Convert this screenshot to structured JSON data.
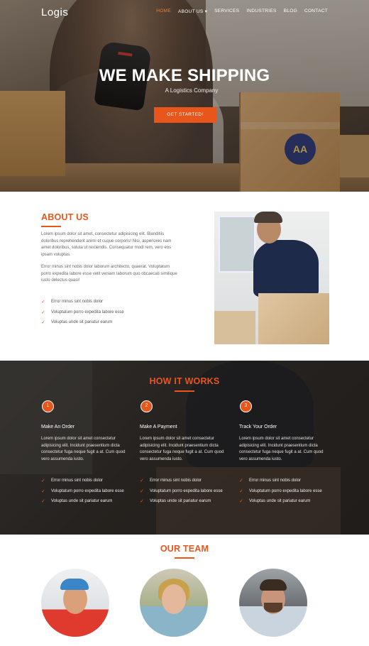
{
  "nav": {
    "logo": "Logis",
    "items": [
      "HOME",
      "ABOUT US ▾",
      "SERVICES",
      "INDUSTRIES",
      "BLOG",
      "CONTACT"
    ],
    "active_index": 0
  },
  "hero": {
    "title": "WE MAKE SHIPPING",
    "subtitle": "A Logistics Company",
    "cta_label": "GET STARTED!",
    "box_logo": "AA"
  },
  "about": {
    "title": "ABOUT US",
    "paragraph1": "Lorem ipsum dolor sit amet, consectetur adipisicing elit. Blanditiis doloribus reprehenderit animi et cuque corporis! Nisi, asperiores nam amet doloribus, soluta ut reiciendis. Consequatur modi rem, vero eos ipsam voluptas.",
    "paragraph2": "Error minus sint nobis dolor laborum architecto, quaerat. Voluptatum porro expedita labore esse velit veniam laborum quo obcaecati similique iusto delectus quasi!",
    "checks": [
      "Error minus sint nobis dolor",
      "Voluptatum porro expedita labore esse",
      "Voluptas unde sit pariatur earum"
    ]
  },
  "how": {
    "title": "HOW IT WORKS",
    "steps": [
      {
        "num": "1",
        "title": "Make An Order",
        "desc": "Lorem ipsum dolor sit amet consectetur adipisicing elit. Incidunt praesentium dicta consectetur fuga neque fugit a at. Cum quod vero assumenda iusto.",
        "checks": [
          "Error minus sint nobis dolor",
          "Voluptatum porro expedita labore esse",
          "Voluptas unde sit pariatur earum"
        ]
      },
      {
        "num": "2",
        "title": "Make A Payment",
        "desc": "Lorem ipsum dolor sit amet consectetur adipisicing elit. Incidunt praesentium dicta consectetur fuga neque fugit a at. Cum quod vero assumenda iusto.",
        "checks": [
          "Error minus sint nobis dolor",
          "Voluptatum porro expedita labore esse",
          "Voluptas unde sit pariatur earum"
        ]
      },
      {
        "num": "3",
        "title": "Track Your Order",
        "desc": "Lorem ipsum dolor sit amet consectetur adipisicing elit. Incidunt praesentium dicta consectetur fuga neque fugit a at. Cum quod vero assumenda iusto.",
        "checks": [
          "Error minus sint nobis dolor",
          "Voluptatum porro expedita labore esse",
          "Voluptas unde sit pariatur earum"
        ]
      }
    ]
  },
  "team": {
    "title": "OUR TEAM"
  },
  "colors": {
    "accent": "#e8561c",
    "dark_section": "#35322d",
    "text": "#666666"
  },
  "icons": {
    "check": "✓"
  }
}
